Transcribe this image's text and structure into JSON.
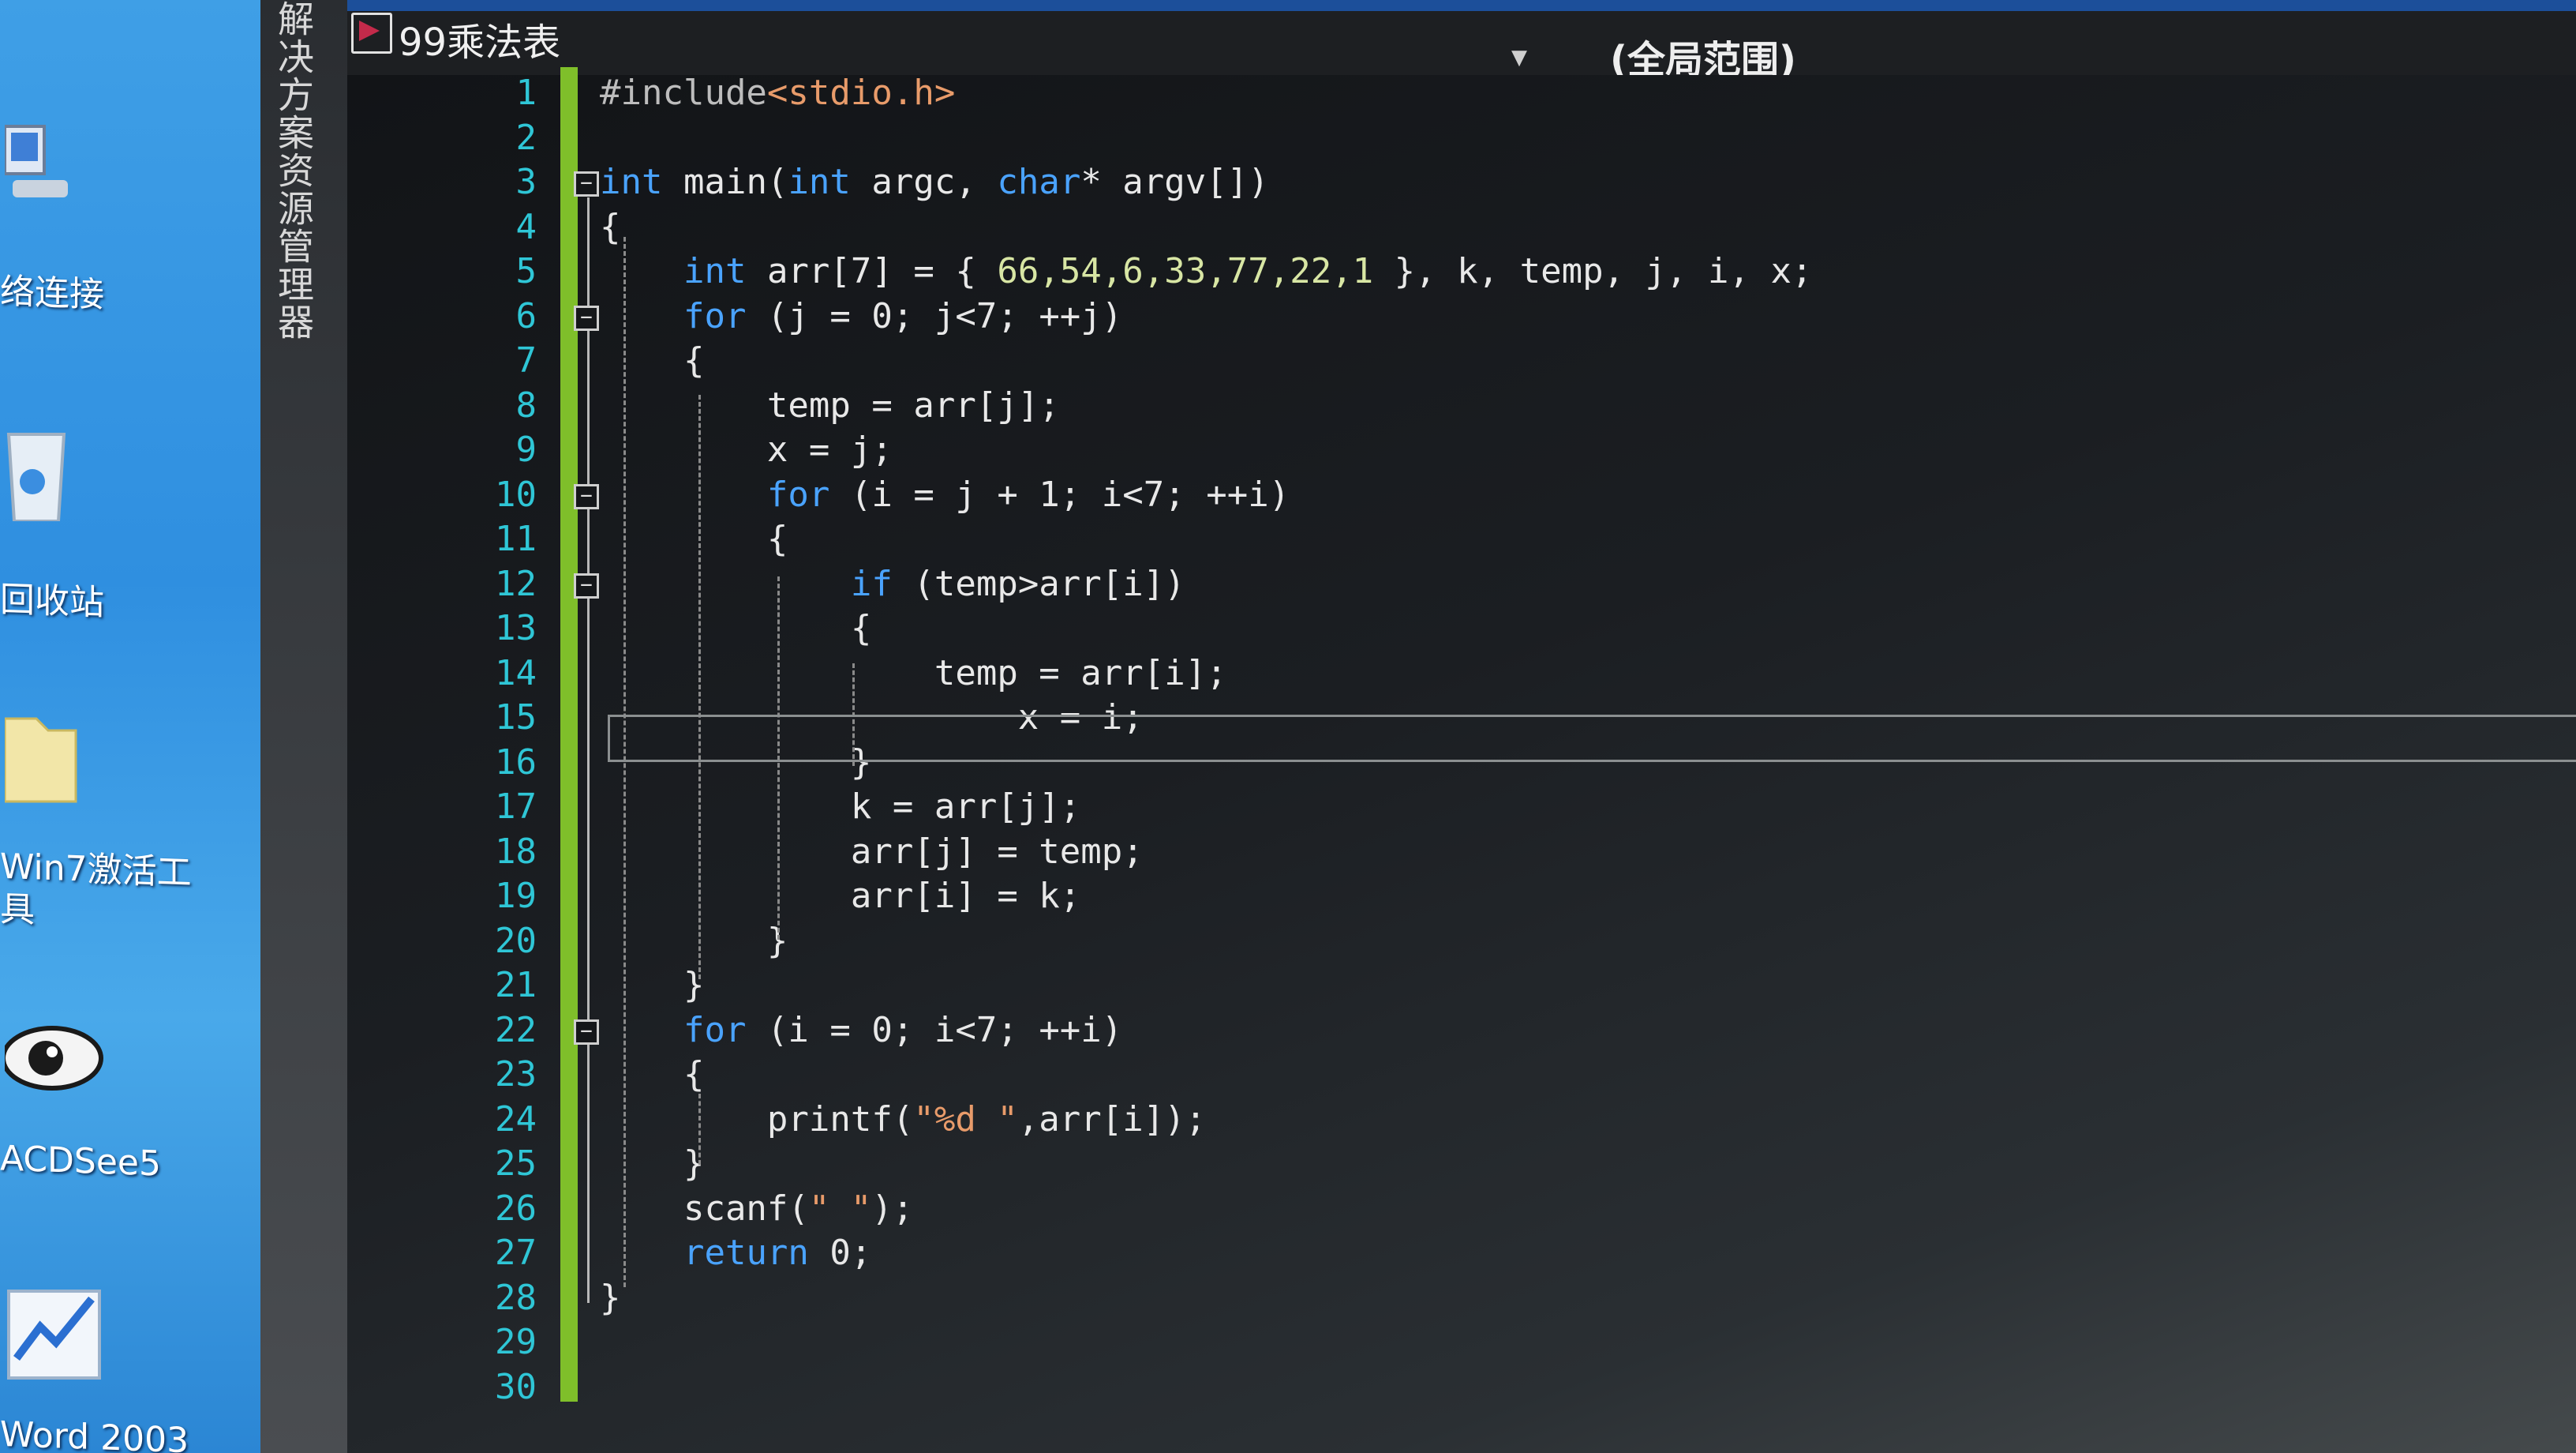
{
  "desktop": {
    "icons": [
      {
        "name": "network-connection-icon",
        "label": "络连接"
      },
      {
        "name": "recycle-bin-icon",
        "label": "回收站"
      },
      {
        "name": "activation-tool-icon",
        "label": "Win7激活工\n具"
      },
      {
        "name": "acdsee-icon",
        "label": "ACDSee5"
      },
      {
        "name": "word-icon",
        "label": "Word 2003"
      }
    ]
  },
  "side_tab": {
    "label": "解决方案资源管理器"
  },
  "tab": {
    "title": "99乘法表"
  },
  "scope": {
    "label": "(全局范围)"
  },
  "editor": {
    "line_numbers": [
      "1",
      "2",
      "3",
      "4",
      "5",
      "6",
      "7",
      "8",
      "9",
      "10",
      "11",
      "12",
      "13",
      "14",
      "15",
      "16",
      "17",
      "18",
      "19",
      "20",
      "21",
      "22",
      "23",
      "24",
      "25",
      "26",
      "27",
      "28",
      "29",
      "30"
    ],
    "lines": [
      [
        {
          "t": "#include",
          "c": "pp"
        },
        {
          "t": "<stdio.h>",
          "c": "str"
        }
      ],
      [],
      [
        {
          "t": "int",
          "c": "kw"
        },
        {
          "t": " main("
        },
        {
          "t": "int",
          "c": "kw"
        },
        {
          "t": " argc, "
        },
        {
          "t": "char",
          "c": "kw"
        },
        {
          "t": "* argv[])"
        }
      ],
      [
        {
          "t": "{"
        }
      ],
      [
        {
          "t": "    "
        },
        {
          "t": "int",
          "c": "kw"
        },
        {
          "t": " arr[7] = { "
        },
        {
          "t": "66,54,6,33,77,22,1",
          "c": "num"
        },
        {
          "t": " }, k, temp, j, i, x;"
        }
      ],
      [
        {
          "t": "    "
        },
        {
          "t": "for",
          "c": "kw"
        },
        {
          "t": " (j = 0; j<7; ++j)"
        }
      ],
      [
        {
          "t": "    {"
        }
      ],
      [
        {
          "t": "        temp = arr[j];"
        }
      ],
      [
        {
          "t": "        x = j;"
        }
      ],
      [
        {
          "t": "        "
        },
        {
          "t": "for",
          "c": "kw"
        },
        {
          "t": " (i = j + 1; i<7; ++i)"
        }
      ],
      [
        {
          "t": "        {"
        }
      ],
      [
        {
          "t": "            "
        },
        {
          "t": "if",
          "c": "kw"
        },
        {
          "t": " (temp>arr[i])"
        }
      ],
      [
        {
          "t": "            {"
        }
      ],
      [
        {
          "t": "                temp = arr[i];"
        }
      ],
      [
        {
          "t": "                    x = i;"
        }
      ],
      [
        {
          "t": "            }"
        }
      ],
      [
        {
          "t": "            k = arr[j];"
        }
      ],
      [
        {
          "t": "            arr[j] = temp;"
        }
      ],
      [
        {
          "t": "            arr[i] = k;"
        }
      ],
      [
        {
          "t": "        }"
        }
      ],
      [
        {
          "t": "    }"
        }
      ],
      [
        {
          "t": "    "
        },
        {
          "t": "for",
          "c": "kw"
        },
        {
          "t": " (i = 0; i<7; ++i)"
        }
      ],
      [
        {
          "t": "    {"
        }
      ],
      [
        {
          "t": "        printf("
        },
        {
          "t": "\"%d \"",
          "c": "str"
        },
        {
          "t": ",arr[i]);"
        }
      ],
      [
        {
          "t": "    }"
        }
      ],
      [
        {
          "t": "    scanf("
        },
        {
          "t": "\" \"",
          "c": "str"
        },
        {
          "t": ");"
        }
      ],
      [
        {
          "t": "    "
        },
        {
          "t": "return",
          "c": "kw"
        },
        {
          "t": " 0;"
        }
      ],
      [
        {
          "t": "}"
        }
      ],
      [],
      []
    ],
    "fold_markers": [
      3,
      6,
      10,
      12,
      22
    ],
    "current_line": 15
  },
  "colors": {
    "keyword": "#4aa3ff",
    "line_number": "#2fc6d6",
    "change_bar": "#7fbf2a",
    "title_accent": "#1c4f9a"
  }
}
